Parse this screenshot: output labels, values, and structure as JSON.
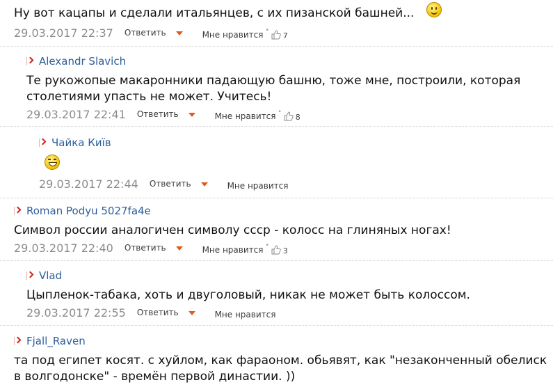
{
  "meta_labels": {
    "reply": "Ответить",
    "like": "Мне нравится"
  },
  "comments": [
    {
      "author": "",
      "text": "Ну вот кацапы и сделали итальянцев, с их пизанской башней...",
      "date": "29.03.2017 22:37",
      "likes": "7"
    },
    {
      "author": "Alexandr Slavich",
      "text": "Те рукожопые макаронники падающую башню, тоже мне, построили, которая столетиями упасть не может. Учитесь!",
      "date": "29.03.2017 22:41",
      "likes": "8"
    },
    {
      "author": "Чайка Київ",
      "text": "",
      "date": "29.03.2017 22:44",
      "likes": ""
    },
    {
      "author": "Roman Podyu 5027fa4e",
      "text": "Символ россии аналогичен символу ссср - колосс на глиняных ногах!",
      "date": "29.03.2017 22:40",
      "likes": "3"
    },
    {
      "author": "Vlad",
      "text": "Цыпленок-табака, хоть и двуголовый, никак не может быть колоссом.",
      "date": "29.03.2017 22:55",
      "likes": ""
    },
    {
      "author": "Fjall_Raven",
      "text": "та под египет косят. с хуйлом, как фараоном. обьявят, как \"незаконченный обелиск в волгодонске\" - времён первой династии. ))",
      "date": "",
      "likes": ""
    }
  ]
}
